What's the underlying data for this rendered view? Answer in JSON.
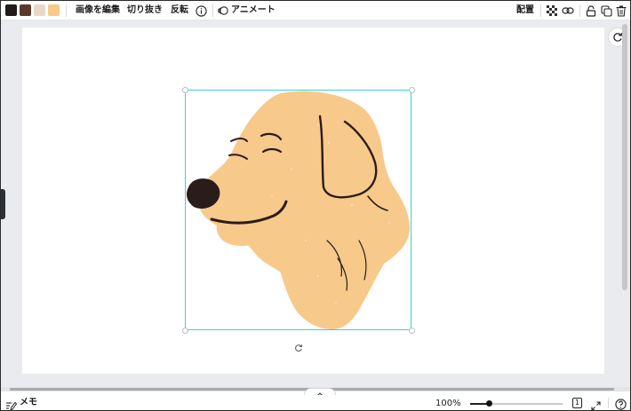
{
  "toolbar": {
    "swatches": [
      {
        "color": "#231b1a"
      },
      {
        "color": "#5b3a2c"
      },
      {
        "color": "#ead8c7"
      },
      {
        "color": "#f8c987"
      }
    ],
    "edit_image_label": "画像を編集",
    "crop_label": "切り抜き",
    "flip_label": "反転",
    "info_icon": "info-icon",
    "animate_label": "アニメート",
    "position_label": "配置"
  },
  "canvas": {
    "page_bg": "#ffffff",
    "selection_color": "#3ecfd4",
    "dog": {
      "fur_color": "#f7c98a",
      "outline_color": "#2a1c19"
    }
  },
  "bottom": {
    "notes_label": "メモ",
    "zoom_label": "100%",
    "page_number": "1",
    "zoom_level": 1.0
  }
}
